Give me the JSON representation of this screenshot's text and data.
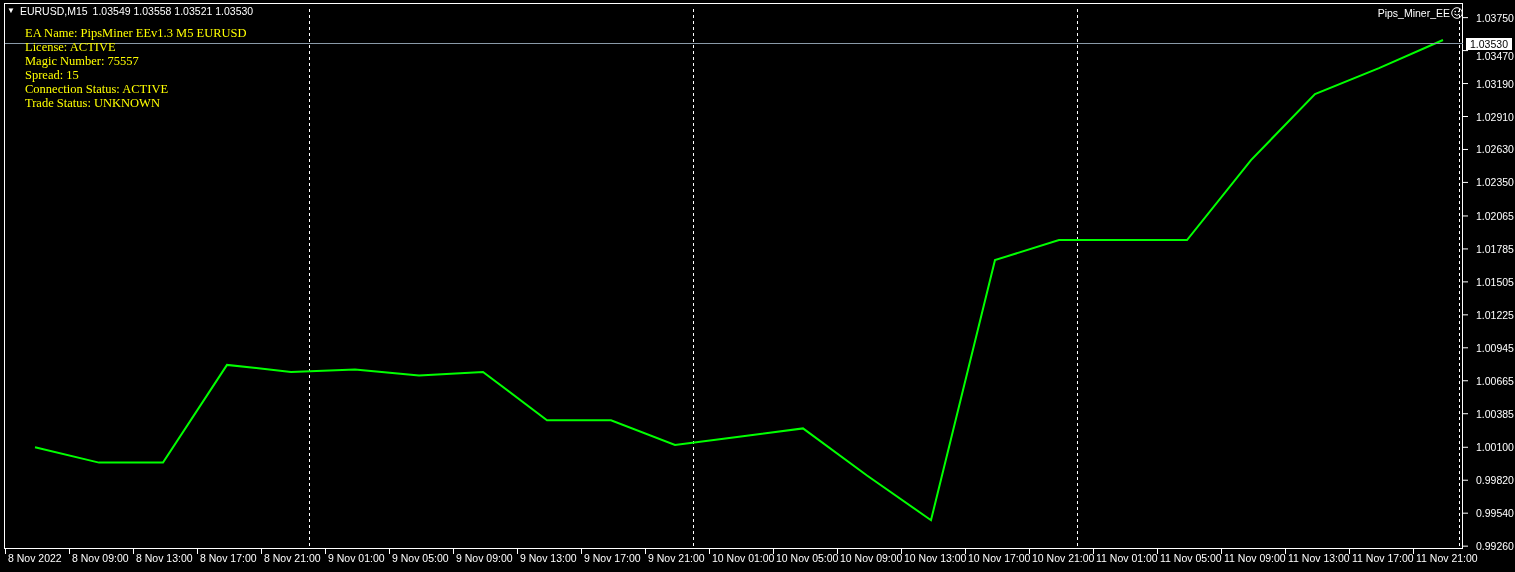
{
  "chart_header": {
    "menu_arrow": "▼",
    "quotes": "1.03549 1.03558 1.03521 1.03530"
  },
  "ea_info": [
    "EA Name: PipsMiner EEv1.3 M5 EURUSD",
    "License: ACTIVE",
    "Magic Number: 75557",
    "Spread: 15",
    "Connection Status: ACTIVE",
    "Trade Status: UNKNOWN"
  ],
  "ea_label": "Pips_Miner_EE",
  "current_price": "1.03530",
  "chart_data": {
    "type": "line",
    "categories": [
      "8 Nov 2022",
      "8 Nov 09:00",
      "8 Nov 13:00",
      "8 Nov 17:00",
      "8 Nov 21:00",
      "9 Nov 01:00",
      "9 Nov 05:00",
      "9 Nov 09:00",
      "9 Nov 13:00",
      "9 Nov 17:00",
      "9 Nov 21:00",
      "10 Nov 01:00",
      "10 Nov 05:00",
      "10 Nov 09:00",
      "10 Nov 13:00",
      "10 Nov 17:00",
      "10 Nov 21:00",
      "11 Nov 01:00",
      "11 Nov 05:00",
      "11 Nov 09:00",
      "11 Nov 13:00",
      "11 Nov 17:00",
      "11 Nov 21:00"
    ],
    "series": [
      {
        "name": "EURUSD,M15",
        "color": "#00ff00",
        "values": [
          1.001,
          0.9997,
          0.9997,
          1.008,
          1.0074,
          1.0076,
          1.0071,
          1.0074,
          1.0033,
          1.0033,
          1.0012,
          1.0019,
          1.0026,
          0.9986,
          0.9948,
          1.0169,
          1.0186,
          1.0186,
          1.0186,
          1.0254,
          1.031,
          1.0332,
          1.0356
        ]
      }
    ],
    "ylim": [
      0.9924,
      1.0387
    ],
    "yticks": [
      {
        "value": 1.0375,
        "label": "1.03750"
      },
      {
        "value": 1.0347,
        "label": "1.03470"
      },
      {
        "value": 1.0319,
        "label": "1.03190"
      },
      {
        "value": 1.0291,
        "label": "1.02910"
      },
      {
        "value": 1.0263,
        "label": "1.02630"
      },
      {
        "value": 1.0235,
        "label": "1.02350"
      },
      {
        "value": 1.02065,
        "label": "1.02065"
      },
      {
        "value": 1.01785,
        "label": "1.01785"
      },
      {
        "value": 1.01505,
        "label": "1.01505"
      },
      {
        "value": 1.01225,
        "label": "1.01225"
      },
      {
        "value": 1.00945,
        "label": "1.00945"
      },
      {
        "value": 1.00665,
        "label": "1.00665"
      },
      {
        "value": 1.00385,
        "label": "1.00385"
      },
      {
        "value": 1.001,
        "label": "1.00100"
      },
      {
        "value": 0.9982,
        "label": "0.99820"
      },
      {
        "value": 0.9954,
        "label": "0.99540"
      },
      {
        "value": 0.9926,
        "label": "0.99260"
      }
    ]
  }
}
